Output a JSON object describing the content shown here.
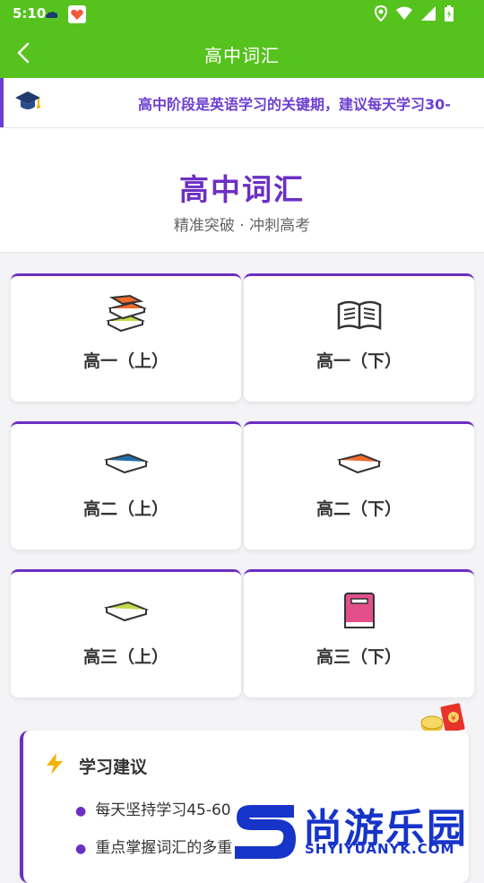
{
  "status_bar": {
    "time": "5:10"
  },
  "app_bar": {
    "title": "高中词汇",
    "back_icon": "chevron-left-icon"
  },
  "notice": {
    "text": "高中阶段是英语学习的关键期，建议每天学习30-"
  },
  "hero": {
    "title": "高中词汇",
    "subtitle": "精准突破 · 冲刺高考"
  },
  "grades": [
    {
      "label": "高一（上）",
      "icon": "books-stack-icon"
    },
    {
      "label": "高一（下）",
      "icon": "open-book-icon"
    },
    {
      "label": "高二（上）",
      "icon": "blue-book-icon"
    },
    {
      "label": "高二（下）",
      "icon": "orange-book-icon"
    },
    {
      "label": "高三（上）",
      "icon": "green-book-icon"
    },
    {
      "label": "高三（下）",
      "icon": "pink-book-icon"
    }
  ],
  "suggestion": {
    "title": "学习建议",
    "items": [
      "每天坚持学习45-60",
      "重点掌握词汇的多重"
    ]
  },
  "watermark": {
    "name": "尚游乐园",
    "url": "SHYIYUANYK.COM"
  },
  "colors": {
    "green": "#56c21e",
    "purple": "#6c2fc4"
  }
}
